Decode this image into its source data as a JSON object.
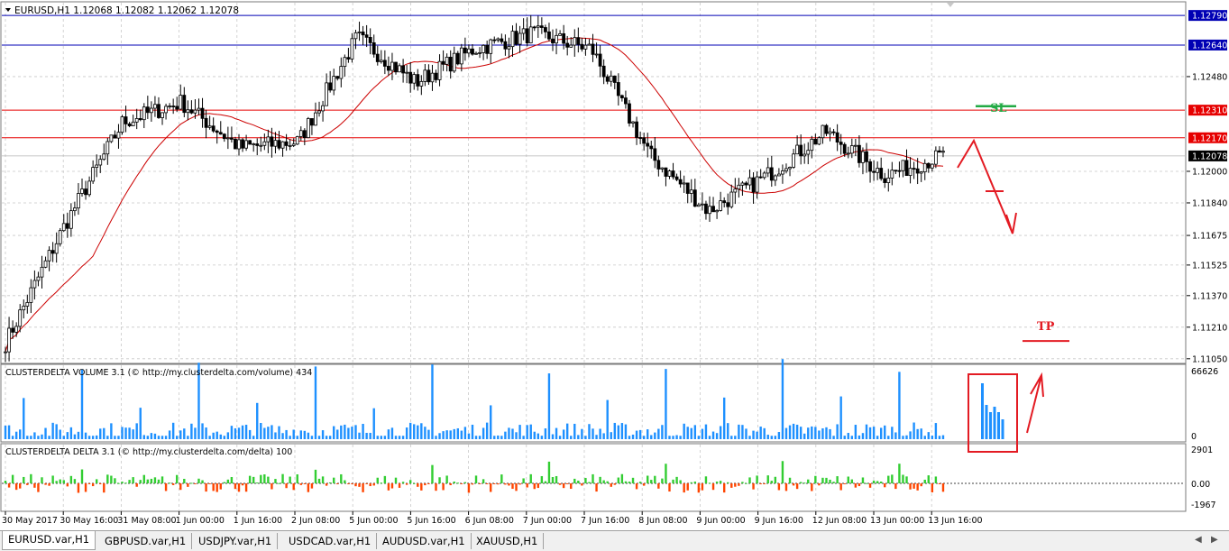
{
  "colors": {
    "candle": "#000000",
    "grid": "#c8c8c8",
    "ma": "#cc0000",
    "blue_line": "#0000b4",
    "red_line": "#e60000",
    "volume_bar": "#1e90ff",
    "delta_pos": "#32cd32",
    "delta_neg": "#ff4500",
    "annotation_red": "#e31b23",
    "annotation_green": "#22aa44"
  },
  "main_chart": {
    "title": "EURUSD,H1  1.12068 1.12082 1.12062 1.12078",
    "ylim": [
      1.1104,
      1.1285
    ],
    "price_labels": [
      "1.12480",
      "1.12000",
      "1.11840",
      "1.11675",
      "1.11525",
      "1.11370",
      "1.11210",
      "1.11050"
    ],
    "levels": [
      {
        "label": "1.12790",
        "price": 1.1279,
        "kind": "blue"
      },
      {
        "label": "1.12640",
        "price": 1.1264,
        "kind": "blue"
      },
      {
        "label": "1.12310",
        "price": 1.1231,
        "kind": "red"
      },
      {
        "label": "1.12170",
        "price": 1.1217,
        "kind": "red"
      }
    ],
    "current_price": {
      "label": "1.12078",
      "price": 1.12078
    },
    "sl_label": "SL",
    "tp_label": "TP",
    "sl_price": 1.1233,
    "tp_price": 1.1114
  },
  "indicators": {
    "volume_title": "CLUSTERDELTA VOLUME 3.1 (© http://my.clusterdelta.com/volume) 434",
    "volume_max_label": "66626",
    "volume_min_label": "0",
    "delta_title": "CLUSTERDELTA DELTA 3.1 (© http://my.clusterdelta.com/delta) 100",
    "delta_labels": [
      "2901",
      "0.00",
      "-1967"
    ]
  },
  "time_labels": [
    "30 May 2017",
    "30 May 16:00",
    "31 May 08:00",
    "1 Jun 00:00",
    "1 Jun 16:00",
    "2 Jun 08:00",
    "5 Jun 00:00",
    "5 Jun 16:00",
    "6 Jun 08:00",
    "7 Jun 00:00",
    "7 Jun 16:00",
    "8 Jun 08:00",
    "9 Jun 00:00",
    "9 Jun 16:00",
    "12 Jun 08:00",
    "13 Jun 00:00",
    "13 Jun 16:00"
  ],
  "chart_data": {
    "type": "line",
    "title": "EURUSD,H1",
    "x": [
      "30 May 2017",
      "30 May 16:00",
      "31 May 08:00",
      "1 Jun 00:00",
      "1 Jun 16:00",
      "2 Jun 08:00",
      "5 Jun 00:00",
      "5 Jun 16:00",
      "6 Jun 08:00",
      "7 Jun 00:00",
      "7 Jun 16:00",
      "8 Jun 08:00",
      "9 Jun 00:00",
      "9 Jun 16:00",
      "12 Jun 08:00",
      "13 Jun 00:00",
      "13 Jun 16:00"
    ],
    "series": [
      {
        "values": [
          1.1113,
          1.1172,
          1.1225,
          1.1235,
          1.1212,
          1.1215,
          1.1268,
          1.1245,
          1.1262,
          1.127,
          1.1262,
          1.1208,
          1.118,
          1.1198,
          1.122,
          1.1198,
          1.12078
        ]
      }
    ],
    "ylim": [
      1.1104,
      1.1285
    ]
  },
  "tabs": [
    {
      "label": "EURUSD.var,H1",
      "active": true
    },
    {
      "label": "GBPUSD.var,H1",
      "active": false
    },
    {
      "label": "USDJPY.var,H1",
      "active": false
    },
    {
      "label": "USDCAD.var,H1",
      "active": false
    },
    {
      "label": "AUDUSD.var,H1",
      "active": false
    },
    {
      "label": "XAUUSD,H1",
      "active": false
    }
  ]
}
